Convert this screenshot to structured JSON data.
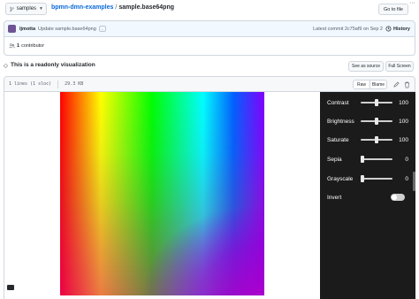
{
  "branch": {
    "label": "samples"
  },
  "breadcrumb": {
    "repo": "bpmn-dmn-examples",
    "separator": "/",
    "file": "sample.base64png"
  },
  "actions": {
    "goto_file": "Go to file",
    "more": "···"
  },
  "commit": {
    "author": "ljmotta",
    "message": "Update sample.base64png",
    "expand": "…",
    "latest": "Latest commit 2c75af9 on Sep 2",
    "history": "History"
  },
  "contributors": {
    "count": "1",
    "label": "contributor"
  },
  "visualization": {
    "title": "This is a readonly visualization",
    "see_as_source": "See as source",
    "full_screen": "Full Screen"
  },
  "file": {
    "lines": "1 lines (1 sloc)",
    "size": "29.3 KB",
    "raw": "Raw",
    "blame": "Blame"
  },
  "filters": [
    {
      "label": "Contrast",
      "value": "100",
      "level": 0.5
    },
    {
      "label": "Brightness",
      "value": "100",
      "level": 0.5
    },
    {
      "label": "Saturate",
      "value": "100",
      "level": 0.5
    },
    {
      "label": "Sepia",
      "value": "0",
      "level": 0
    },
    {
      "label": "Grayscale",
      "value": "0",
      "level": 0
    }
  ],
  "invert": {
    "label": "Invert",
    "on": false
  },
  "colors": {
    "link": "#0969da",
    "panel_bg": "#1b1b1b"
  }
}
